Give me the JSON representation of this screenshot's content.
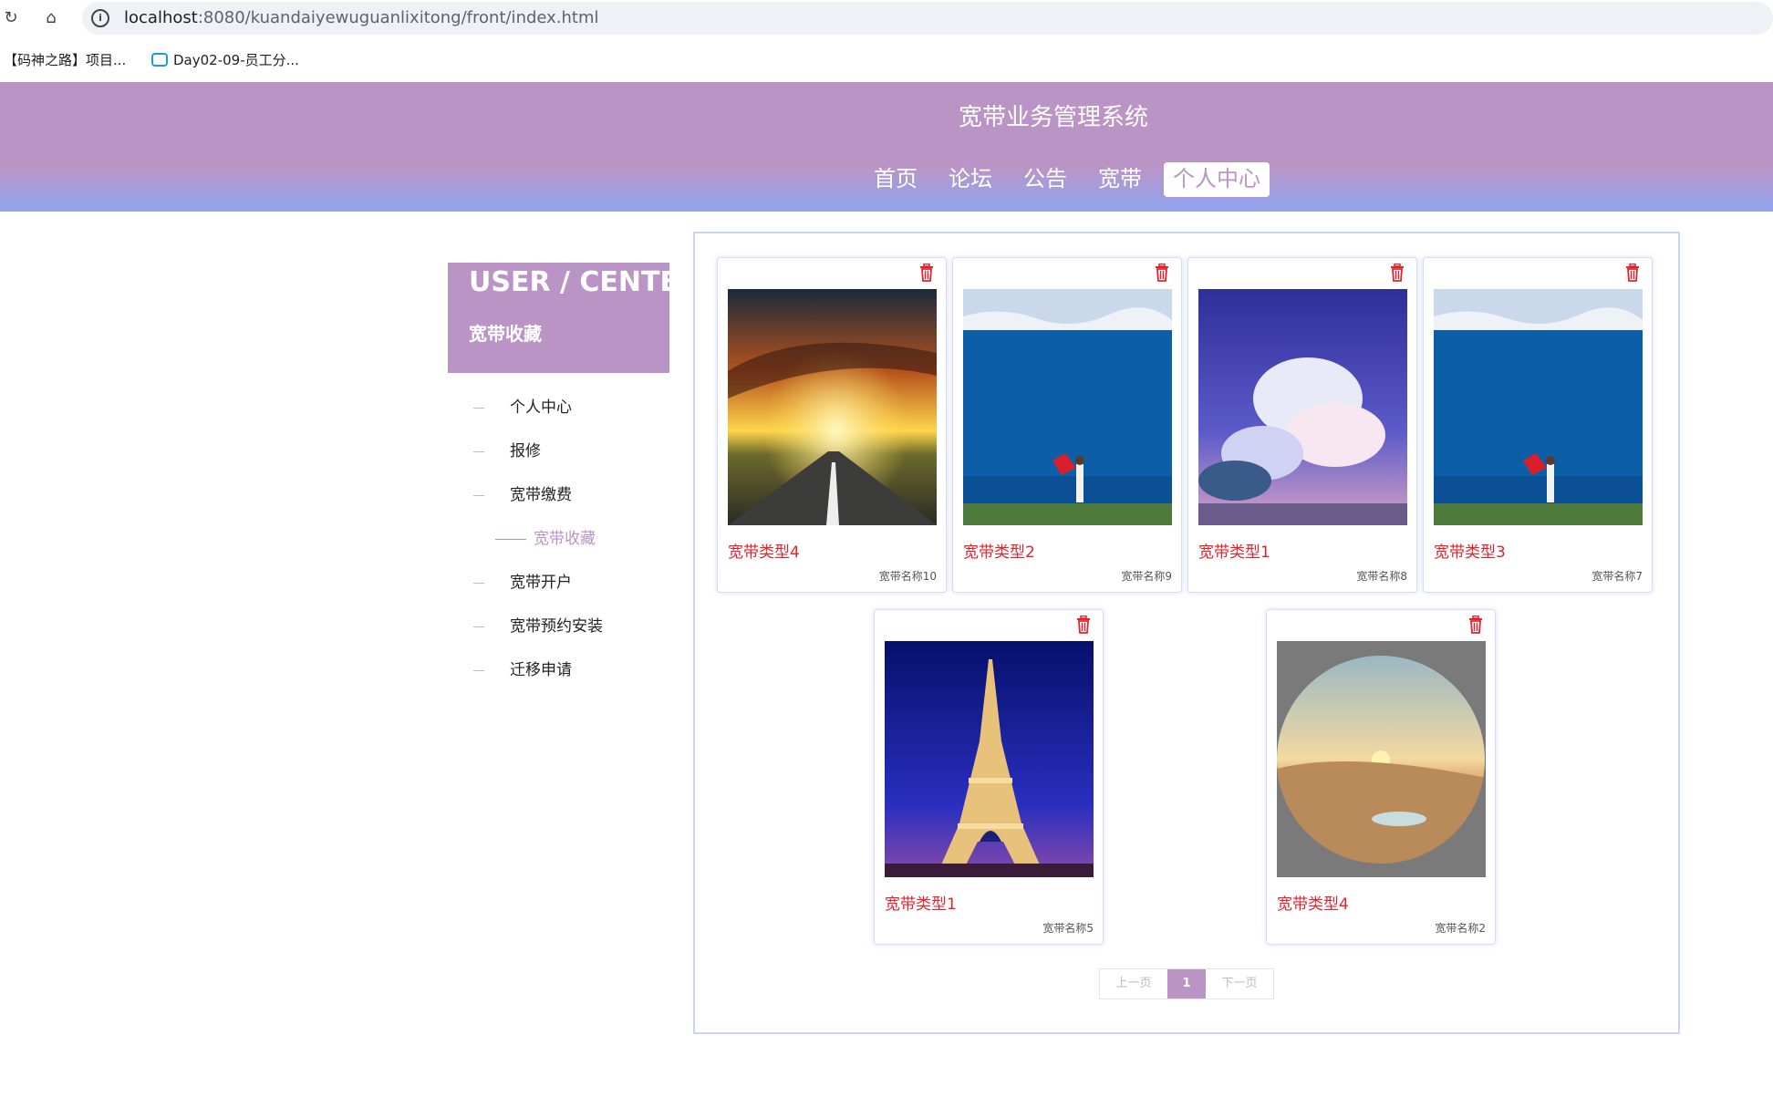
{
  "browser": {
    "url_host": "localhost",
    "url_path": ":8080/kuandaiyewuguanlixitong/front/index.html",
    "bookmarks": [
      "【码神之路】项目...",
      "Day02-09-员工分..."
    ]
  },
  "header": {
    "title": "宽带业务管理系统",
    "menu": [
      "首页",
      "论坛",
      "公告",
      "宽带",
      "个人中心"
    ],
    "active_menu": "个人中心",
    "colors": {
      "primary": "#bb94c6",
      "gradient_end": "#8ea5ef"
    }
  },
  "sidebar": {
    "title_en": "USER / CENTER",
    "title_cn": "宽带收藏",
    "items": [
      "个人中心",
      "报修",
      "宽带缴费",
      "宽带收藏",
      "宽带开户",
      "宽带预约安装",
      "迁移申请"
    ],
    "active": "宽带收藏"
  },
  "cards": [
    {
      "type": "宽带类型4",
      "name": "宽带名称10",
      "image": "sunset-road"
    },
    {
      "type": "宽带类型2",
      "name": "宽带名称9",
      "image": "sea-woman-umbrella"
    },
    {
      "type": "宽带类型1",
      "name": "宽带名称8",
      "image": "anime-clouds"
    },
    {
      "type": "宽带类型3",
      "name": "宽带名称7",
      "image": "sea-woman-umbrella"
    },
    {
      "type": "宽带类型1",
      "name": "宽带名称5",
      "image": "eiffel-tower"
    },
    {
      "type": "宽带类型4",
      "name": "宽带名称2",
      "image": "desert-oasis"
    }
  ],
  "pager": {
    "prev": "上一页",
    "current": "1",
    "next": "下一页"
  }
}
